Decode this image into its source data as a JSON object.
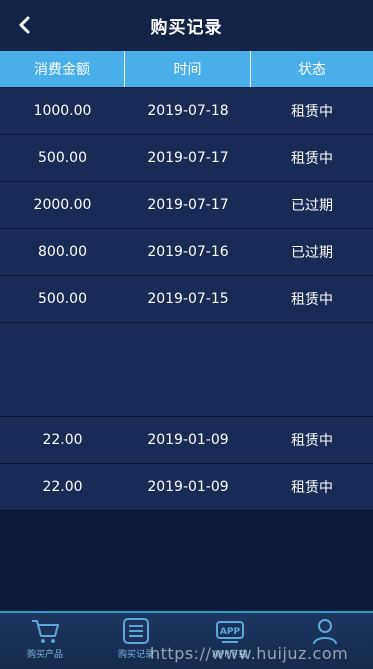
{
  "header": {
    "title": "购买记录"
  },
  "table": {
    "columns": [
      "消费金额",
      "时间",
      "状态"
    ],
    "rows": [
      {
        "amount": "1000.00",
        "date": "2019-07-18",
        "status": "租赁中"
      },
      {
        "amount": "500.00",
        "date": "2019-07-17",
        "status": "租赁中"
      },
      {
        "amount": "2000.00",
        "date": "2019-07-17",
        "status": "已过期"
      },
      {
        "amount": "800.00",
        "date": "2019-07-16",
        "status": "已过期"
      },
      {
        "amount": "500.00",
        "date": "2019-07-15",
        "status": "租赁中"
      },
      {
        "amount": "22.00",
        "date": "2019-01-09",
        "status": "租赁中"
      },
      {
        "amount": "22.00",
        "date": "2019-01-09",
        "status": "租赁中"
      }
    ]
  },
  "nav": {
    "items": [
      {
        "label": "购买产品",
        "icon": "cart-icon"
      },
      {
        "label": "购买记录",
        "icon": "list-icon"
      },
      {
        "label": "APP下载",
        "icon": "app-icon"
      },
      {
        "label": "",
        "icon": "user-icon"
      }
    ]
  },
  "watermark": "https://www.huijuz.com",
  "colors": {
    "accent": "#4aaee8",
    "background": "#0e1a3c",
    "row": "#182a55"
  }
}
